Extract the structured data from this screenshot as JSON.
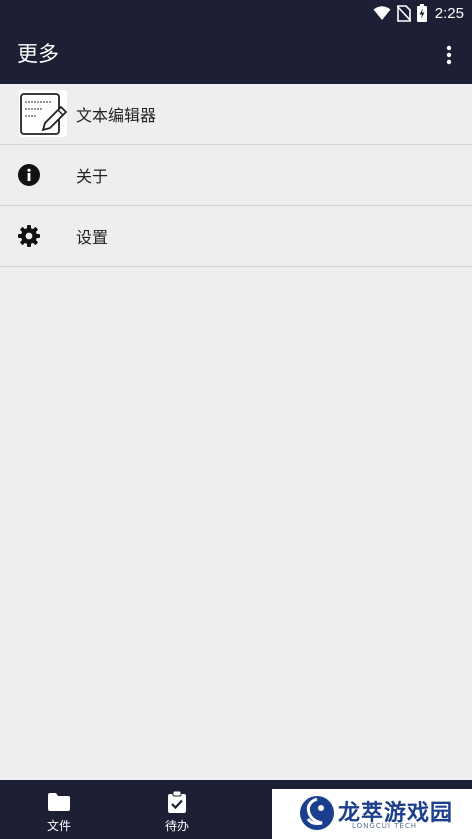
{
  "status_bar": {
    "time": "2:25"
  },
  "app_bar": {
    "title": "更多"
  },
  "menu_items": [
    {
      "label": "文本编辑器",
      "icon": "text-editor-app-icon"
    },
    {
      "label": "关于",
      "icon": "info-icon"
    },
    {
      "label": "设置",
      "icon": "gear-icon"
    }
  ],
  "bottom_nav": [
    {
      "label": "文件",
      "icon": "folder-icon"
    },
    {
      "label": "待办",
      "icon": "clipboard-check-icon"
    }
  ],
  "watermark": {
    "title": "龙萃游戏园",
    "subtitle": "LONGCUI TECH"
  },
  "colors": {
    "bar_bg": "#1d2035",
    "list_bg": "#eeeeee",
    "divider": "#d4d4d4",
    "watermark_text": "#1b3f8c"
  }
}
